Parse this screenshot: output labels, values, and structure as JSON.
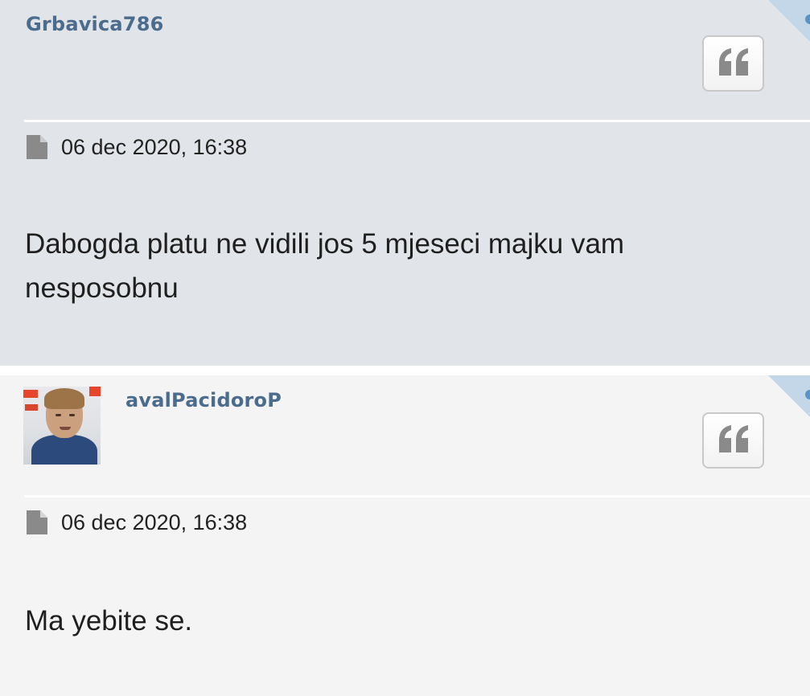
{
  "posts": [
    {
      "username": "Grbavica786",
      "timestamp": "06 dec 2020, 16:38",
      "message": "Dabogda platu ne vidili jos 5 mjeseci majku vam nesposobnu"
    },
    {
      "username": "avalPacidoroP",
      "timestamp": "06 dec 2020, 16:38",
      "message": "Ma yebite se."
    }
  ],
  "icons": {
    "quote": "quote-icon",
    "document": "document-icon",
    "avatar": "avatar"
  },
  "colors": {
    "username": "#4b6c8d",
    "post_background_odd": "#e1e4e8",
    "post_background_even": "#f4f4f4",
    "corner_accent": "#c4d7e9"
  }
}
